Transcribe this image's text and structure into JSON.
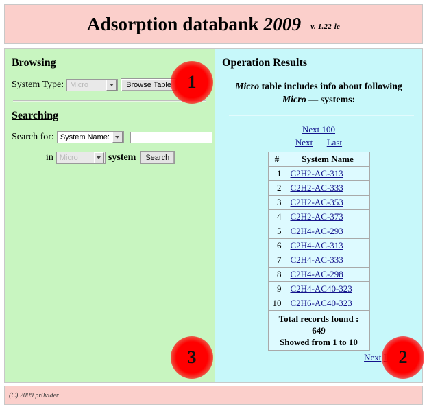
{
  "header": {
    "title_main": "Adsorption databank",
    "title_year": "2009",
    "version": "v. 1.22-le"
  },
  "left_panel": {
    "browsing": {
      "heading": "Browsing",
      "system_type_label": "System Type:",
      "system_type_value": "Micro",
      "browse_button": "Browse Table"
    },
    "searching": {
      "heading": "Searching",
      "search_for_label": "Search for:",
      "search_field_value": "System Name:",
      "search_text_value": "",
      "search_text_placeholder": "",
      "in_label": "in",
      "in_system_value": "Micro",
      "system_label": "system",
      "search_button": "Search"
    }
  },
  "right_panel": {
    "heading": "Operation Results",
    "caption_table_name": "Micro",
    "caption_line1_rest": " table includes info about following",
    "caption_line2_prefix": "Micro",
    "caption_line2_rest": " — systems:",
    "pager_top": {
      "next_100": "Next 100",
      "next": "Next",
      "last": "Last"
    },
    "pager_bottom": {
      "next": "Next",
      "last": "Last"
    },
    "table": {
      "columns": [
        "#",
        "System Name"
      ],
      "rows": [
        {
          "num": "1",
          "name": "C2H2-AC-313"
        },
        {
          "num": "2",
          "name": "C2H2-AC-333"
        },
        {
          "num": "3",
          "name": "C2H2-AC-353"
        },
        {
          "num": "4",
          "name": "C2H2-AC-373"
        },
        {
          "num": "5",
          "name": "C2H4-AC-293"
        },
        {
          "num": "6",
          "name": "C2H4-AC-313"
        },
        {
          "num": "7",
          "name": "C2H4-AC-333"
        },
        {
          "num": "8",
          "name": "C2H4-AC-298"
        },
        {
          "num": "9",
          "name": "C2H4-AC40-323"
        },
        {
          "num": "10",
          "name": "C2H6-AC40-323"
        }
      ],
      "total_line1": "Total records found : 649",
      "total_line2": "Showed from 1 to 10"
    }
  },
  "footer": {
    "copyright": "(C) 2009 pr0vider"
  },
  "annotations": {
    "badge_1": "1",
    "badge_2": "2",
    "badge_3": "3"
  },
  "colors": {
    "header_bg": "#fbcfcb",
    "left_panel_bg": "#c8f5c0",
    "right_panel_bg": "#c7f8fa",
    "table_bg": "#ddfaff",
    "link": "#14148c",
    "badge": "#ff0000"
  }
}
